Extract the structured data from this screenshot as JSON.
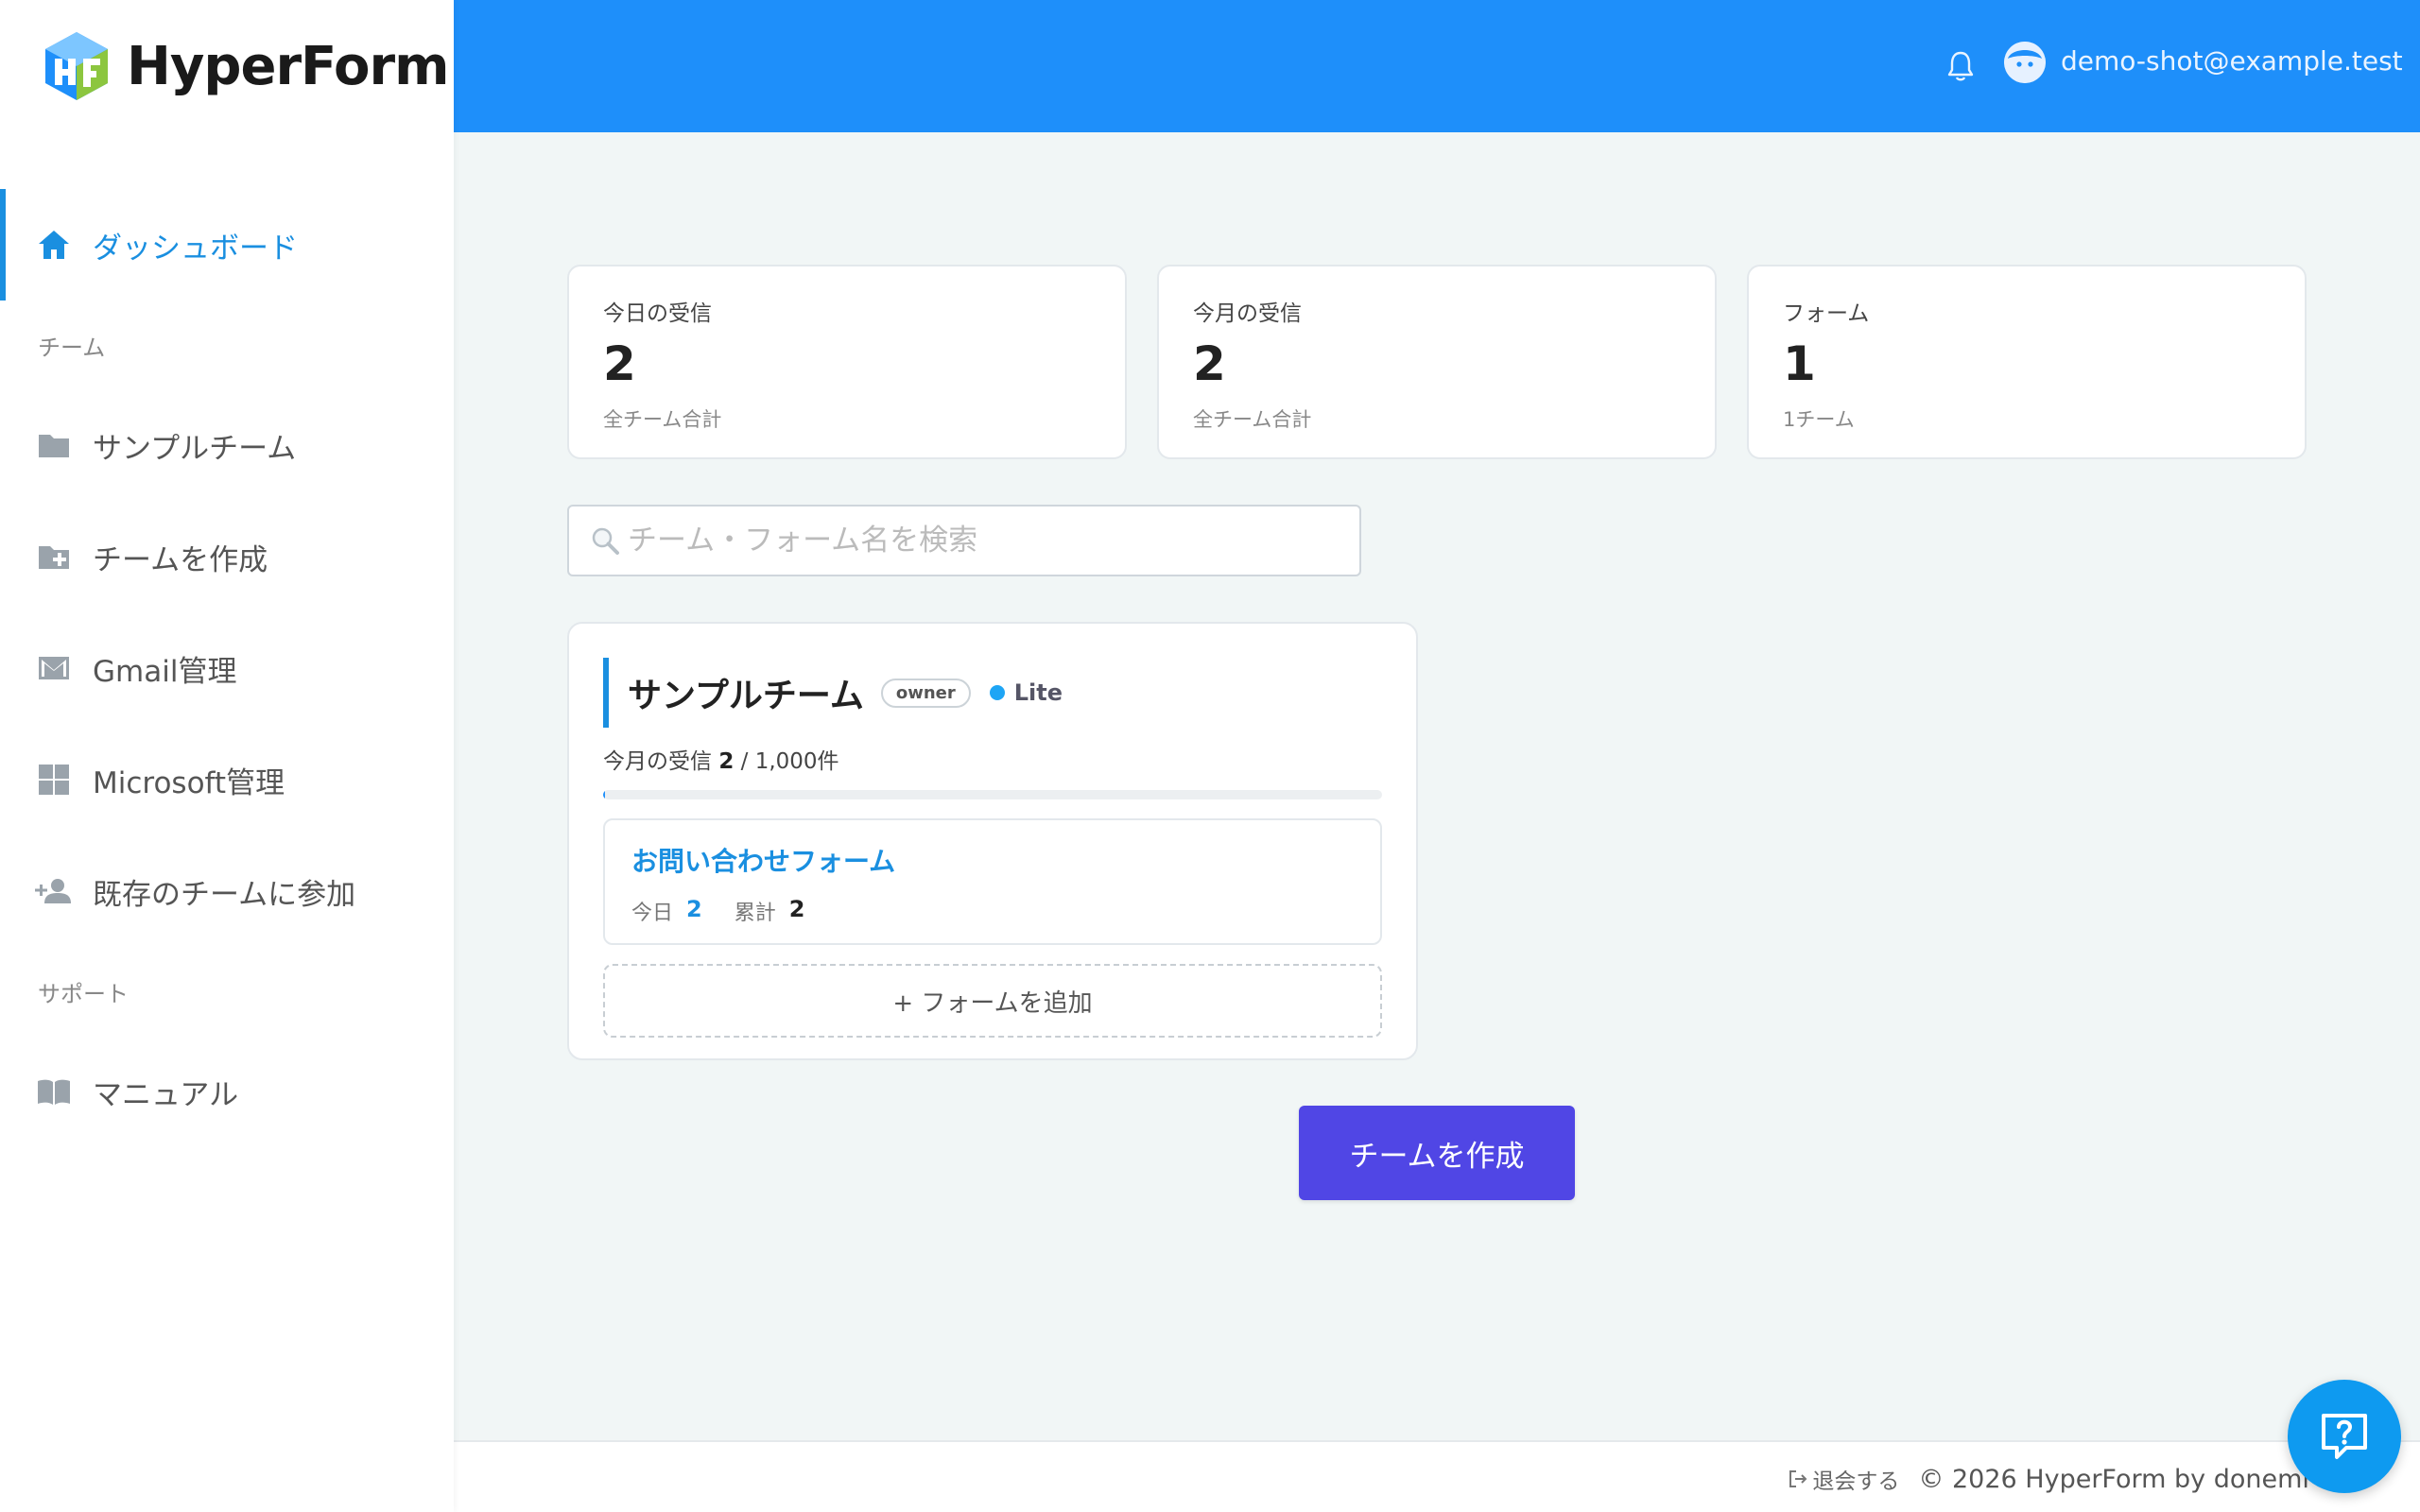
{
  "brand": {
    "name": "HyperForm"
  },
  "sidebar": {
    "items": [
      {
        "label": "ダッシュボード",
        "icon": "home-icon"
      },
      {
        "label": "サンプルチーム",
        "icon": "folder-icon"
      },
      {
        "label": "チームを作成",
        "icon": "folder-add-icon"
      },
      {
        "label": "Gmail管理",
        "icon": "mail-icon"
      },
      {
        "label": "Microsoft管理",
        "icon": "windows-icon"
      },
      {
        "label": "既存のチームに参加",
        "icon": "person-add-icon"
      },
      {
        "label": "マニュアル",
        "icon": "book-icon"
      }
    ],
    "sections": {
      "team": "チーム",
      "support": "サポート"
    }
  },
  "header": {
    "user_email": "demo-shot@example.test"
  },
  "stats": [
    {
      "label": "今日の受信",
      "value": "2",
      "sub": "全チーム合計"
    },
    {
      "label": "今月の受信",
      "value": "2",
      "sub": "全チーム合計"
    },
    {
      "label": "フォーム",
      "value": "1",
      "sub": "1チーム"
    }
  ],
  "search": {
    "placeholder": "チーム・フォーム名を検索",
    "value": ""
  },
  "team_card": {
    "name": "サンプルチーム",
    "role": "owner",
    "plan": "Lite",
    "usage_label": "今月の受信",
    "usage_count": "2",
    "usage_limit": "/ 1,000件",
    "usage_fraction": 0.002,
    "forms": [
      {
        "title": "お問い合わせフォーム",
        "today_label": "今日",
        "today": "2",
        "total_label": "累計",
        "total": "2"
      }
    ],
    "add_form_label": "+ フォームを追加"
  },
  "create_team_button": "チームを作成",
  "footer": {
    "logout": "退会する",
    "copyright": "© 2026 HyperForm by donemi Inc."
  },
  "colors": {
    "accent": "#1e8ffa",
    "primary_button": "#5046e5",
    "active_nav": "#1a8fe0"
  }
}
